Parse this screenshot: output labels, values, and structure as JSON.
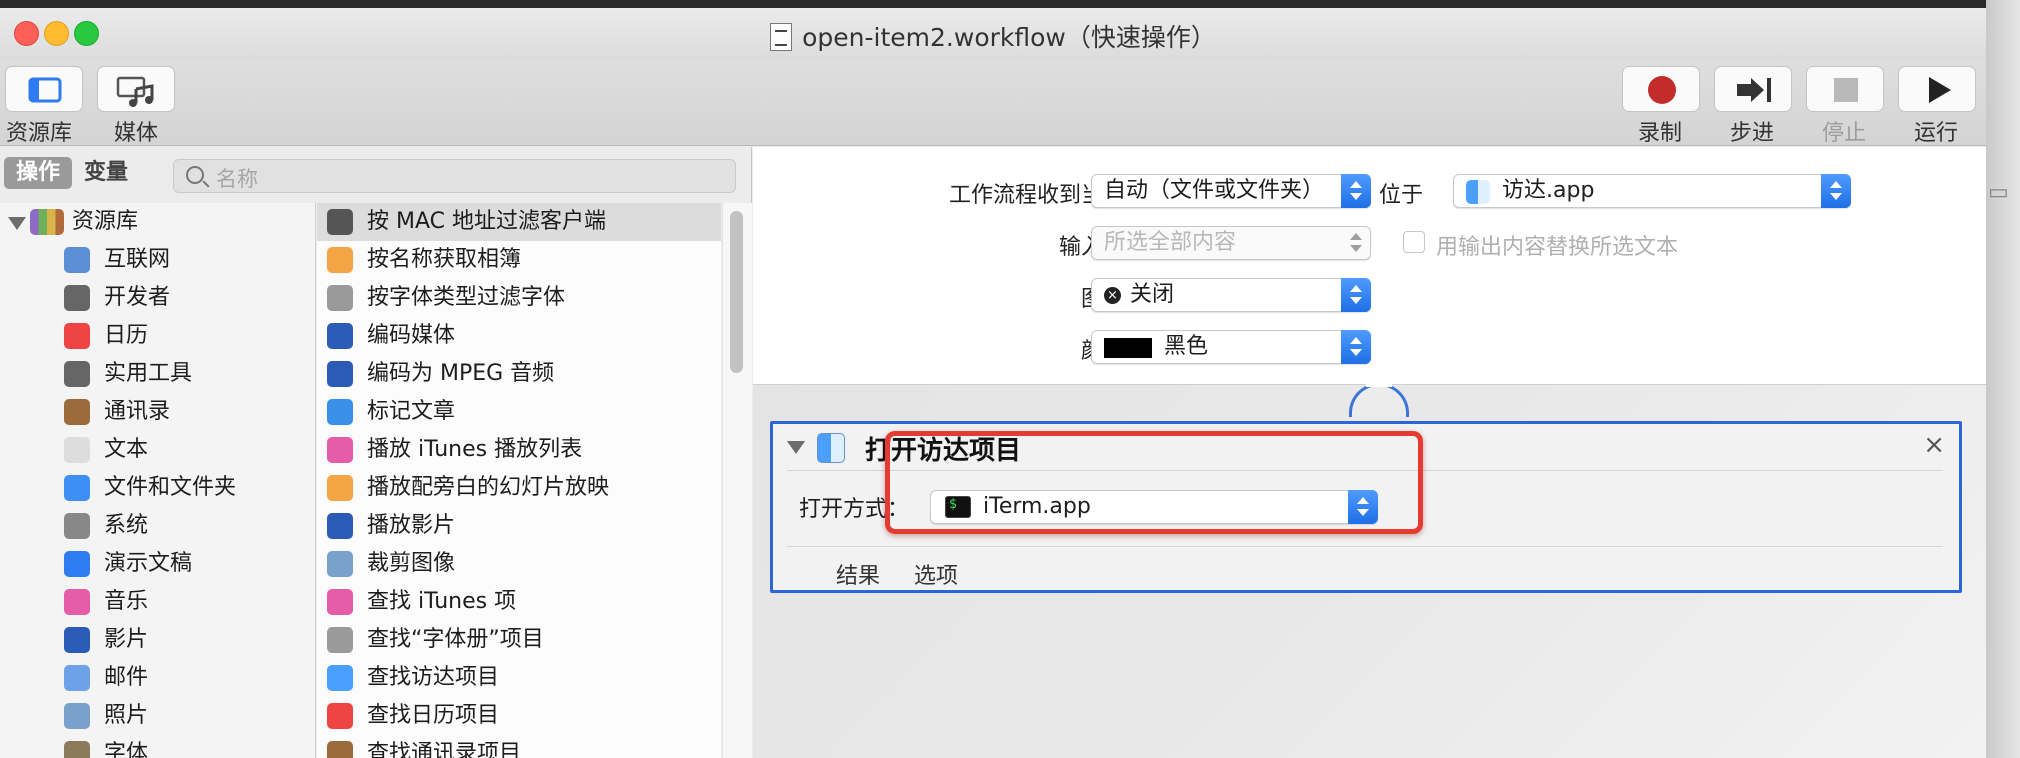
{
  "window": {
    "title": "open-item2.workflow（快速操作）"
  },
  "toolbar": {
    "library_label": "资源库",
    "media_label": "媒体",
    "record_label": "录制",
    "step_label": "步进",
    "stop_label": "停止",
    "run_label": "运行"
  },
  "library": {
    "tab_actions": "操作",
    "tab_variables": "变量",
    "search_placeholder": "名称",
    "root": "资源库",
    "categories": [
      "互联网",
      "开发者",
      "日历",
      "实用工具",
      "通讯录",
      "文本",
      "文件和文件夹",
      "系统",
      "演示文稿",
      "音乐",
      "影片",
      "邮件",
      "照片",
      "字体"
    ],
    "actions": [
      "按 MAC 地址过滤客户端",
      "按名称获取相簿",
      "按字体类型过滤字体",
      "编码媒体",
      "编码为 MPEG 音频",
      "标记文章",
      "播放 iTunes 播放列表",
      "播放配旁白的幻灯片放映",
      "播放影片",
      "裁剪图像",
      "查找 iTunes 项",
      "查找“字体册”项目",
      "查找访达项目",
      "查找日历项目",
      "查找通讯录项目"
    ]
  },
  "workflow": {
    "receives_label": "工作流程收到当前",
    "receives_value": "自动（文件或文件夹）",
    "in_label": "位于",
    "in_value": "访达.app",
    "input_label": "输入为",
    "input_value": "所选全部内容",
    "replace_label": "用输出内容替换所选文本",
    "image_label": "图像",
    "image_value": "关闭",
    "color_label": "颜色",
    "color_value": "黑色",
    "color_swatch": "#000000"
  },
  "action": {
    "title": "打开访达项目",
    "open_with_label": "打开方式：",
    "open_with_value": "iTerm.app",
    "tab_results": "结果",
    "tab_options": "选项",
    "close_glyph": "×"
  },
  "colors": {
    "accent": "#2c66d6",
    "highlight": "#e53a2f",
    "record": "#c42b2b"
  }
}
